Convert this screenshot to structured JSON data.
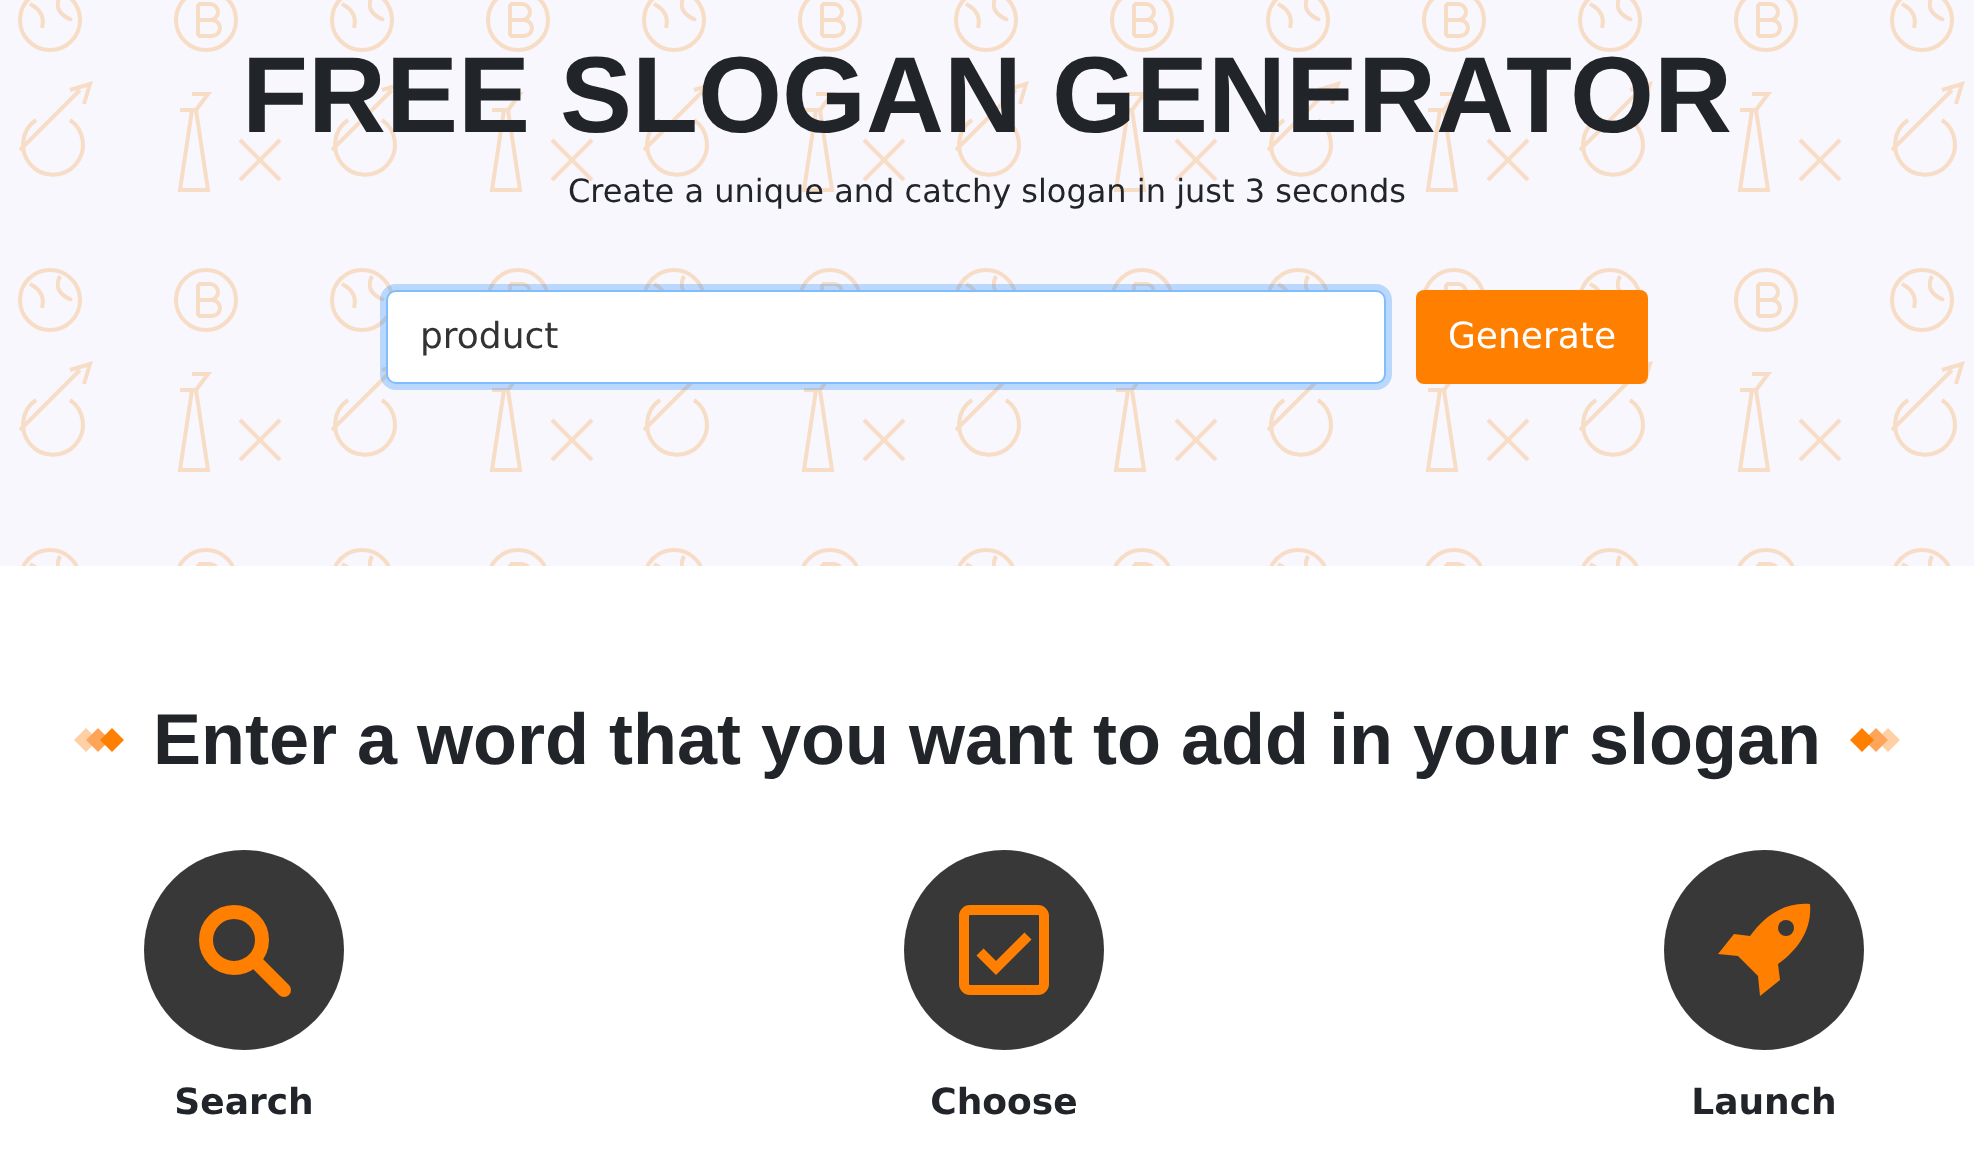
{
  "hero": {
    "title": "FREE SLOGAN GENERATOR",
    "subtitle": "Create a unique and catchy slogan in just 3 seconds",
    "field": {
      "value": "product",
      "focused": true
    },
    "button": "Generate"
  },
  "steps_heading": "Enter a word that you want to add in your slogan",
  "steps": [
    {
      "kind": "search",
      "label": "Search"
    },
    {
      "kind": "check",
      "label": "Choose"
    },
    {
      "kind": "rocket",
      "label": "Launch"
    }
  ]
}
